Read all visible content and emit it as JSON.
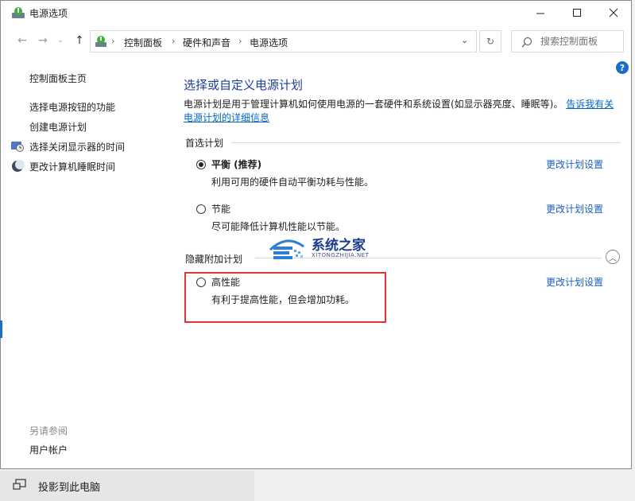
{
  "window": {
    "title": "电源选项",
    "controls": {
      "minimize_icon": "minimize-icon",
      "maximize_icon": "maximize-icon",
      "close_icon": "close-icon"
    }
  },
  "address_bar": {
    "breadcrumbs": [
      "控制面板",
      "硬件和声音",
      "电源选项"
    ],
    "search_placeholder": "搜索控制面板"
  },
  "sidebar": {
    "home": "控制面板主页",
    "items": [
      {
        "label": "选择电源按钮的功能",
        "icon": ""
      },
      {
        "label": "创建电源计划",
        "icon": ""
      },
      {
        "label": "选择关闭显示器的时间",
        "icon": "monitor-clock-icon"
      },
      {
        "label": "更改计算机睡眠时间",
        "icon": "moon-icon"
      }
    ],
    "see_also_title": "另请参阅",
    "see_also_items": [
      "用户帐户"
    ]
  },
  "main": {
    "heading": "选择或自定义电源计划",
    "description": "电源计划是用于管理计算机如何使用电源的一套硬件和系统设置(如显示器亮度、睡眠等)。",
    "description_link": "告诉我有关电源计划的详细信息",
    "preferred_group": "首选计划",
    "hidden_group": "隐藏附加计划",
    "plans": [
      {
        "name": "平衡 (推荐)",
        "desc": "利用可用的硬件自动平衡功耗与性能。",
        "selected": true,
        "action": "更改计划设置"
      },
      {
        "name": "节能",
        "desc": "尽可能降低计算机性能以节能。",
        "selected": false,
        "action": "更改计划设置"
      },
      {
        "name": "高性能",
        "desc": "有利于提高性能，但会增加功耗。",
        "selected": false,
        "action": "更改计划设置"
      }
    ]
  },
  "watermark": {
    "title": "系统之家",
    "sub": "XITONGZHIJIA.NET"
  },
  "taskbar_item": {
    "label": "投影到此电脑"
  },
  "colors": {
    "heading": "#1e3e9c",
    "link": "#1a5cc7",
    "highlight_box": "#e03535"
  }
}
